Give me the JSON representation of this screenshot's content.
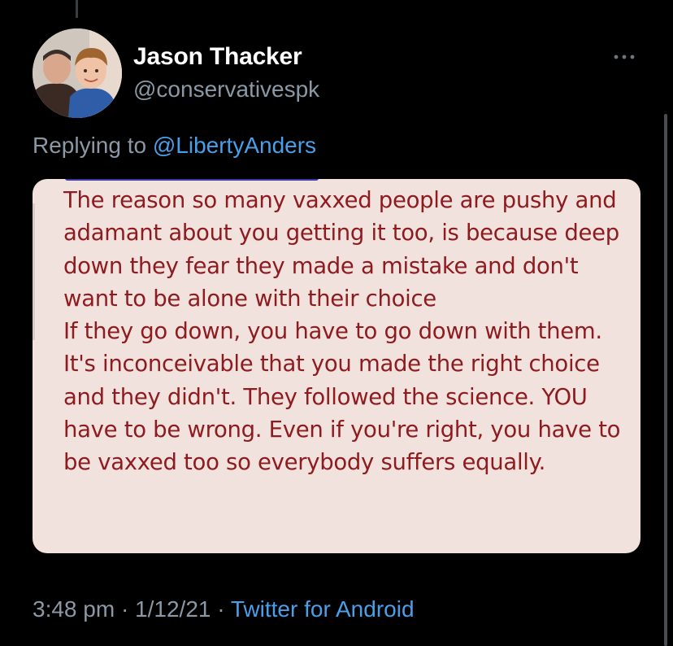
{
  "tweet": {
    "display_name": "Jason Thacker",
    "handle": "@conservativespk",
    "replying_prefix": "Replying to ",
    "replying_to": "@LibertyAnders",
    "timestamp": "3:48 pm · 1/12/21 · ",
    "source": "Twitter for Android"
  },
  "media": {
    "paragraph_1": "The reason so many vaxxed people are pushy and adamant about you getting it too, is because deep down they fear they made a mistake and don't want to be alone with their choice",
    "paragraph_2": "If they go down, you have to go down with them. It's inconceivable that you made the right choice and they didn't. They followed the science. YOU have to be wrong. Even if you're right, you have to be vaxxed too so everybody suffers equally."
  },
  "icons": {
    "more": "more-horizontal-icon",
    "avatar": "profile-photo"
  },
  "colors": {
    "background": "#000000",
    "link": "#4a9fe8",
    "secondary_text": "#8b98a5",
    "media_background": "#f1e2dd",
    "media_text": "#8e1b1f"
  }
}
